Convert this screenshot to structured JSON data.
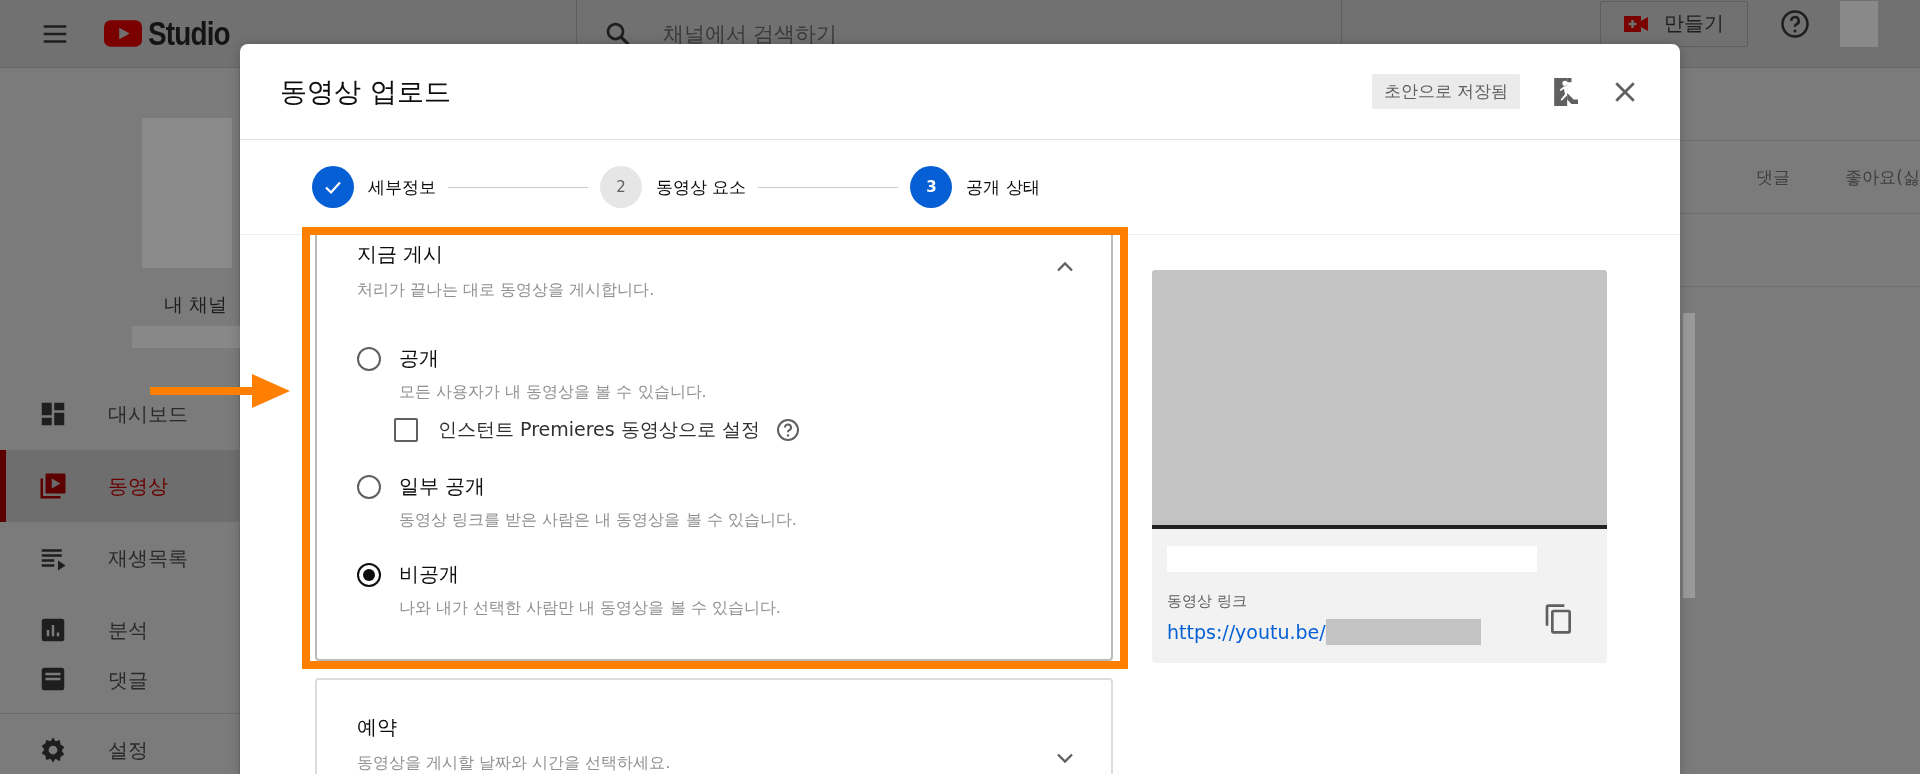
{
  "app_bar": {
    "logo_text": "Studio",
    "search": {
      "placeholder": "채널에서 검색하기"
    },
    "create_button": "만들기"
  },
  "sidebar": {
    "channel_label": "내 채널",
    "items": [
      {
        "label": "대시보드",
        "selected": false
      },
      {
        "label": "동영상",
        "selected": true
      },
      {
        "label": "재생목록",
        "selected": false
      },
      {
        "label": "분석",
        "selected": false
      },
      {
        "label": "댓글",
        "selected": false
      }
    ],
    "footer_item": "설정"
  },
  "background_table": {
    "columns": [
      "댓글",
      "좋아요(싫"
    ]
  },
  "dialog": {
    "title": "동영상 업로드",
    "save_status": "초안으로 저장됨",
    "steps": [
      {
        "label": "세부정보",
        "done": true,
        "selected": false
      },
      {
        "number": "2",
        "label": "동영상 요소",
        "done": false,
        "selected": false
      },
      {
        "number": "3",
        "label": "공개 상태",
        "done": false,
        "selected": true
      }
    ],
    "sections": [
      {
        "title": "지금 게시",
        "description": "처리가 끝나는 대로 동영상을 게시합니다.",
        "expanded": true,
        "highlighted": true,
        "options": [
          {
            "label": "공개",
            "description": "모든 사용자가 내 동영상을 볼 수 있습니다.",
            "selected": false,
            "sub_option": {
              "label": "인스턴트 Premieres 동영상으로 설정",
              "checked": false
            }
          },
          {
            "label": "일부 공개",
            "description": "동영상 링크를 받은 사람은 내 동영상을 볼 수 있습니다.",
            "selected": false
          },
          {
            "label": "비공개",
            "description": "나와 내가 선택한 사람만 내 동영상을 볼 수 있습니다.",
            "selected": true
          }
        ]
      },
      {
        "title": "예약",
        "description": "동영상을 게시할 날짜와 시간을 선택하세요.",
        "expanded": false,
        "highlighted": false
      }
    ],
    "preview": {
      "link_label": "동영상 링크",
      "link": "https://youtu.be/"
    }
  }
}
